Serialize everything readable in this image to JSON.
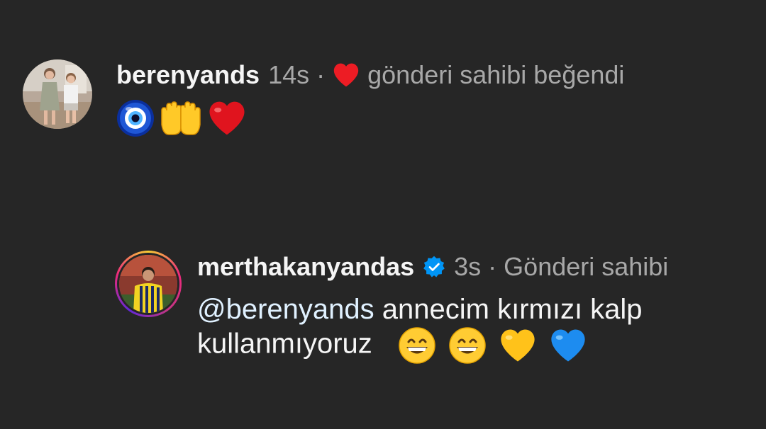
{
  "comment1": {
    "username": "berenyands",
    "time": "14s",
    "separator": "·",
    "liked_text": "gönderi sahibi beğendi",
    "emojis": [
      "nazar-amulet",
      "raising-hands",
      "red-heart"
    ]
  },
  "comment2": {
    "username": "merthakanyandas",
    "time": "3s",
    "separator": "·",
    "badge_text": "Gönderi sahibi",
    "mention": "@berenyands",
    "text_line1": " annecim kırmızı kalp",
    "text_line2": "kullanmıyoruz",
    "emojis": [
      "grinning-face",
      "grinning-face",
      "yellow-heart",
      "blue-heart"
    ]
  },
  "colors": {
    "background": "#262626",
    "primary_text": "#f5f5f5",
    "secondary_text": "#a8a8a8",
    "heart_red": "#ed1c24",
    "verified_blue": "#0095f6",
    "mention": "#e0f1ff"
  }
}
